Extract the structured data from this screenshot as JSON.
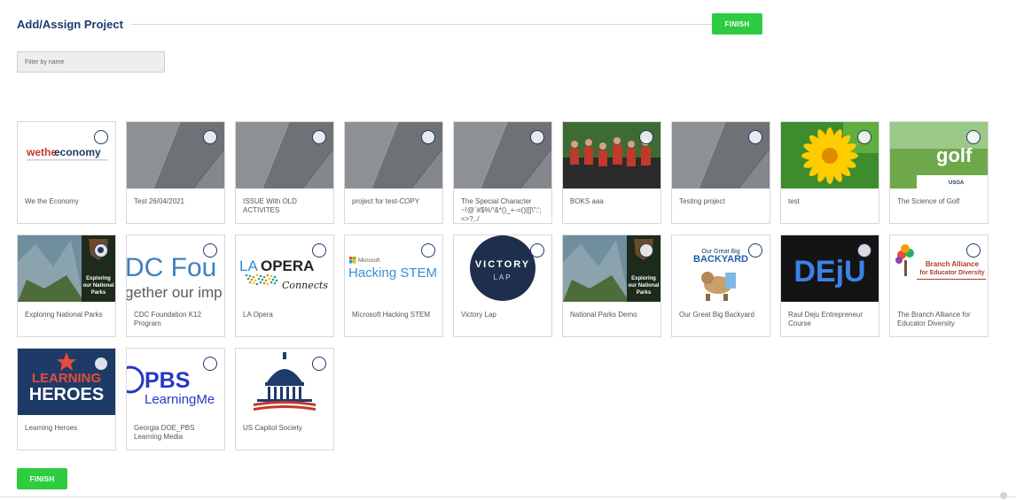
{
  "header": {
    "title": "Add/Assign Project",
    "finish_label": "FINISH"
  },
  "filter": {
    "placeholder": "Filter by name",
    "value": ""
  },
  "footer": {
    "finish_label": "FINISH"
  },
  "colors": {
    "accent_green": "#2ecc40",
    "title_blue": "#1f3a6b",
    "radio_blue": "#1f3a6b"
  },
  "projects": [
    {
      "title": "We the Economy",
      "thumb": "wetheeconomy",
      "logo_text": "wetheeconomy",
      "selected": false
    },
    {
      "title": "Test 26/04/2021",
      "thumb": "gray-architecture",
      "selected": false
    },
    {
      "title": "ISSUE With OLD ACTIVITES",
      "thumb": "gray-architecture",
      "selected": false
    },
    {
      "title": "project for test-COPY",
      "thumb": "gray-architecture",
      "selected": false
    },
    {
      "title": "The Special Character ~!@`#$%^&*()_+-=()|[]\\\":';<>?,./",
      "thumb": "gray-architecture",
      "selected": false
    },
    {
      "title": "BOKS aaa",
      "thumb": "running-kids",
      "selected": false
    },
    {
      "title": "Testing project",
      "thumb": "gray-architecture",
      "selected": false
    },
    {
      "title": "test",
      "thumb": "yellow-flower",
      "selected": false
    },
    {
      "title": "The Science of Golf",
      "thumb": "golf",
      "logo_text": "golf",
      "selected": false
    },
    {
      "title": "Exploring National Parks",
      "thumb": "national-parks",
      "logo_text": "Exploring our National Parks",
      "selected": true
    },
    {
      "title": "CDC Foundation K12 Program",
      "thumb": "cdc-foundation",
      "logo_text": "DC Fou",
      "logo_subtext": "gether our imp",
      "selected": false
    },
    {
      "title": "LA Opera",
      "thumb": "la-opera",
      "logo_text": "LAOPERA",
      "logo_subtext": "Connects",
      "selected": false
    },
    {
      "title": "Microsoft Hacking STEM",
      "thumb": "hacking-stem",
      "logo_text": "Hacking STEM",
      "logo_subtext": "Microsoft",
      "selected": false
    },
    {
      "title": "Victory Lap",
      "thumb": "victory-lap",
      "logo_text": "VICTORY",
      "logo_subtext": "LAP",
      "selected": false
    },
    {
      "title": "National Parks Demo",
      "thumb": "national-parks",
      "logo_text": "Exploring our National Parks",
      "selected": false
    },
    {
      "title": "Our Great Big Backyard",
      "thumb": "backyard",
      "logo_text": "BACKYARD",
      "logo_subtext": "Our Great Big",
      "selected": false
    },
    {
      "title": "Raul Deju Entrepreneur Course",
      "thumb": "deju",
      "logo_text": "DEjU",
      "selected": false
    },
    {
      "title": "The Branch Alliance for Educator Diversity",
      "thumb": "branch-alliance",
      "logo_text": "Branch Alliance",
      "logo_subtext": "for Educator Diversity",
      "selected": false
    },
    {
      "title": "Learning Heroes",
      "thumb": "learning-heroes",
      "logo_text": "LEARNING",
      "logo_subtext": "HEROES",
      "selected": false
    },
    {
      "title": "Georgia DOE_PBS Learning Media",
      "thumb": "pbs",
      "logo_text": "PBS",
      "logo_subtext": "LearningMe",
      "selected": false
    },
    {
      "title": "US Capitol Society",
      "thumb": "capitol",
      "selected": false
    }
  ]
}
